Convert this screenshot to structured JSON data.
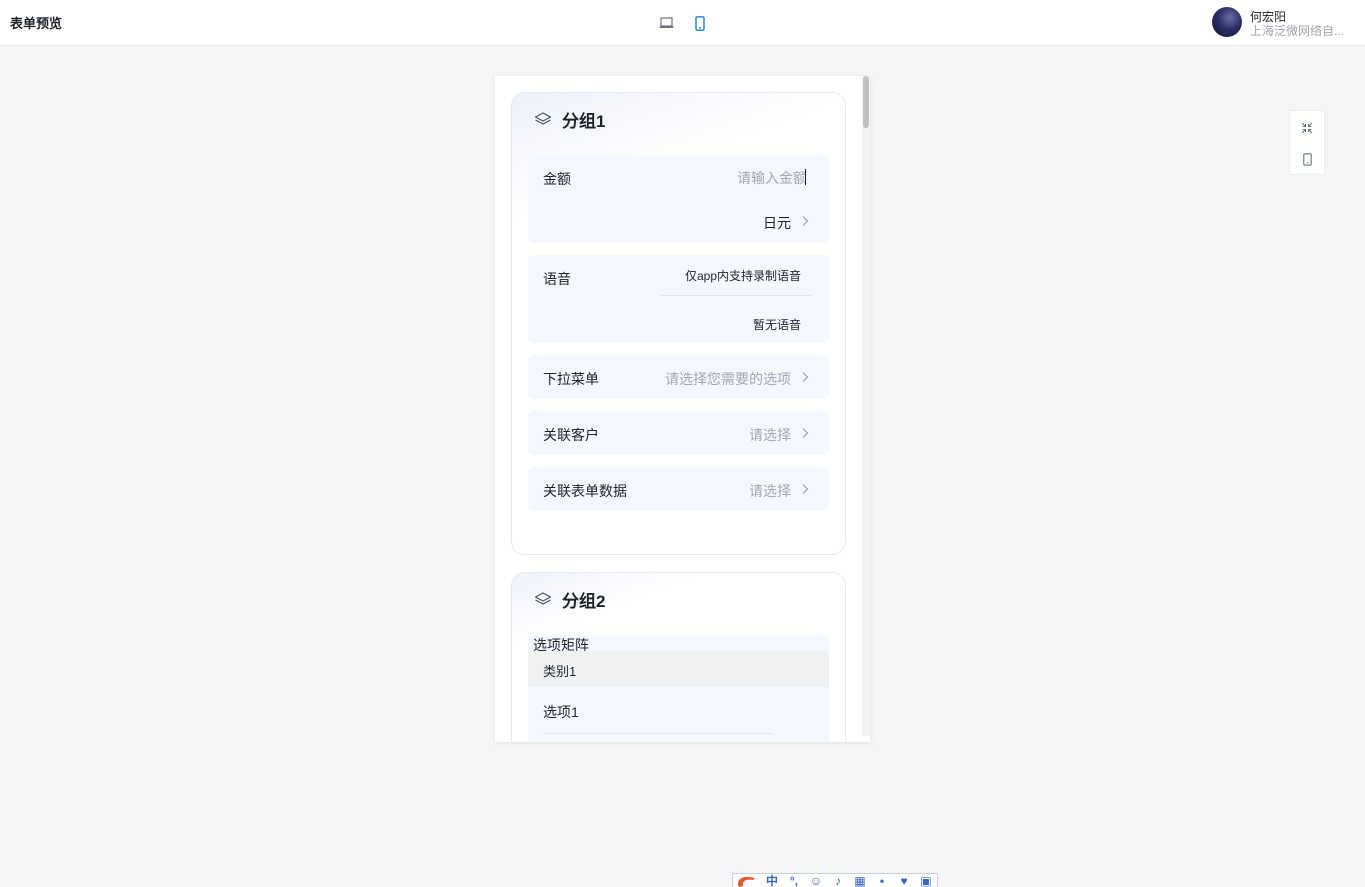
{
  "header": {
    "title": "表单预览",
    "user": {
      "name": "何宏阳",
      "org": "上海泛微网络自..."
    }
  },
  "group1": {
    "title": "分组1",
    "amount": {
      "label": "金额",
      "placeholder": "请输入金额",
      "currency": "日元"
    },
    "voice": {
      "label": "语音",
      "hint": "仅app内支持录制语音",
      "empty": "暂无语音"
    },
    "dropdown": {
      "label": "下拉菜单",
      "placeholder": "请选择您需要的选项"
    },
    "customer": {
      "label": "关联客户",
      "placeholder": "请选择"
    },
    "form_data": {
      "label": "关联表单数据",
      "placeholder": "请选择"
    }
  },
  "group2": {
    "title": "分组2",
    "matrix": {
      "label": "选项矩阵",
      "category": "类别1",
      "option": "选项1"
    }
  },
  "ime": {
    "mode": "中"
  },
  "colors": {
    "accent": "#1a7ed6",
    "field_bg": "#f4f7fd",
    "placeholder": "#a3a8b0"
  }
}
